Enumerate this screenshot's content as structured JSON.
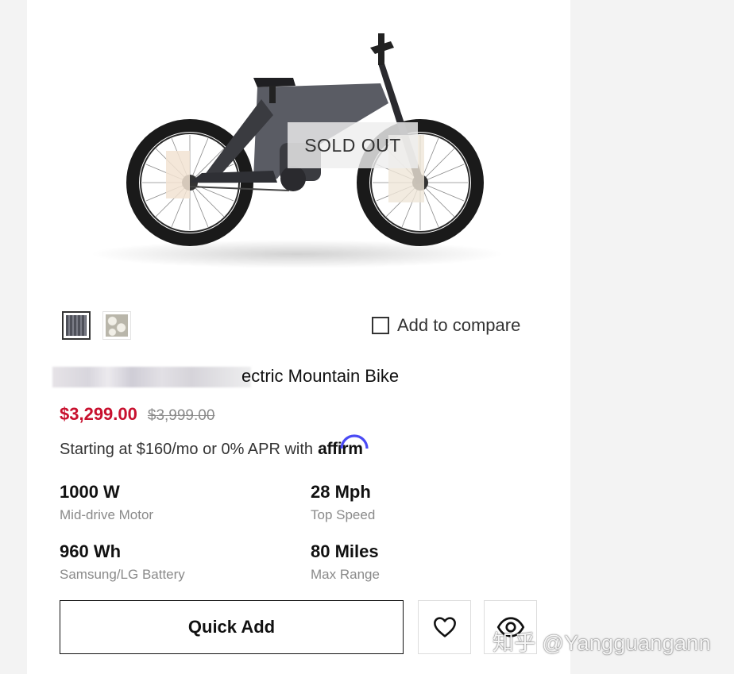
{
  "product": {
    "badge": "SOLD OUT",
    "title_visible": "ectric Mountain Bike",
    "price": "$3,299.00",
    "compare_price": "$3,999.00",
    "finance_text": "Starting at $160/mo or 0% APR with",
    "finance_brand": "affirm",
    "compare_label": "Add to compare",
    "compare_checked": false,
    "swatches": [
      {
        "name": "dark-gray",
        "selected": true,
        "color": "#5a5c66"
      },
      {
        "name": "camo",
        "selected": false,
        "color": "#c9c7bd"
      }
    ],
    "specs": [
      {
        "value": "1000 W",
        "label": "Mid-drive Motor"
      },
      {
        "value": "28 Mph",
        "label": "Top Speed"
      },
      {
        "value": "960 Wh",
        "label": "Samsung/LG Battery"
      },
      {
        "value": "80 Miles",
        "label": "Max Range"
      }
    ]
  },
  "actions": {
    "quick_add": "Quick Add",
    "wishlist_icon": "heart-icon",
    "quickview_icon": "eye-icon"
  },
  "watermark": "知乎 @Yangguangann",
  "colors": {
    "sale_price": "#c8102e",
    "muted": "#8a8a8a",
    "affirm_arc": "#4a4af4"
  }
}
